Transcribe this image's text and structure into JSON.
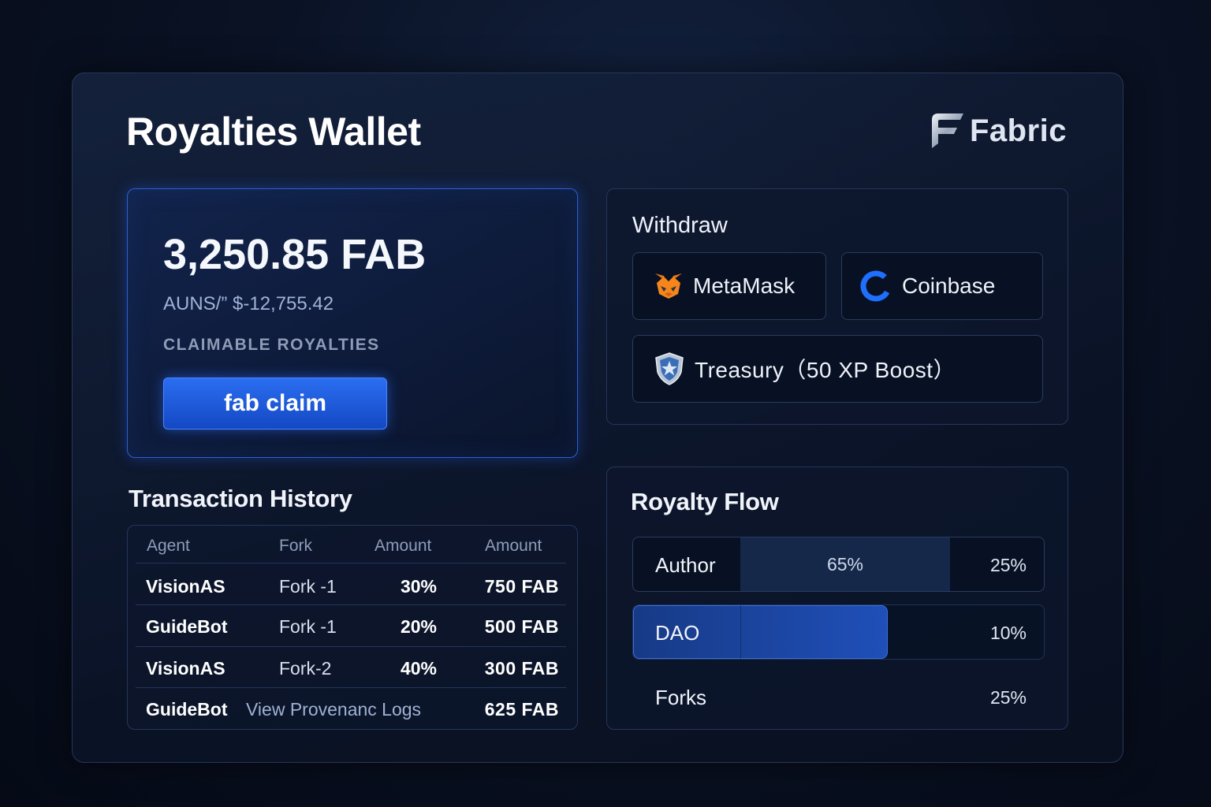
{
  "page_title": "Royalties Wallet",
  "brand": {
    "name": "Fabric",
    "logo_icon": "fabric-f-logo"
  },
  "balance": {
    "amount": "3,250.85 FAB",
    "usd": "AUNS/” $-12,755.42",
    "label": "CLAIMABLE ROYALTIES",
    "claim_label": "fab claim"
  },
  "withdraw": {
    "title": "Withdraw",
    "options": [
      {
        "label": "MetaMask",
        "icon": "metamask-fox-icon"
      },
      {
        "label": "Coinbase",
        "icon": "coinbase-icon"
      },
      {
        "label": "Treasury（50 XP Boost）",
        "icon": "shield-star-icon"
      }
    ]
  },
  "transactions": {
    "title": "Transaction History",
    "columns": [
      "Agent",
      "Fork",
      "Amount",
      "Amount"
    ],
    "rows": [
      {
        "agent": "VisionAS",
        "fork": "Fork -1",
        "pct": "30%",
        "amount": "750 FAB"
      },
      {
        "agent": "GuideBot",
        "fork": "Fork -1",
        "pct": "20%",
        "amount": "500 FAB"
      },
      {
        "agent": "VisionAS",
        "fork": "Fork-2",
        "pct": "40%",
        "amount": "300 FAB"
      }
    ],
    "last_row": {
      "agent": "GuideBot",
      "link": "View Provenanc Logs",
      "amount": "625 FAB"
    }
  },
  "royalty_flow": {
    "title": "Royalty Flow",
    "rows": [
      {
        "name": "Author",
        "mid_label": "65%",
        "value": "25%"
      },
      {
        "name": "DAO",
        "value": "10%",
        "fill_fraction": 0.62
      },
      {
        "name": "Forks",
        "value": "25%"
      }
    ],
    "colors": {
      "author_fill": "#15284a",
      "dao_fill": "#1e4fb8"
    }
  }
}
